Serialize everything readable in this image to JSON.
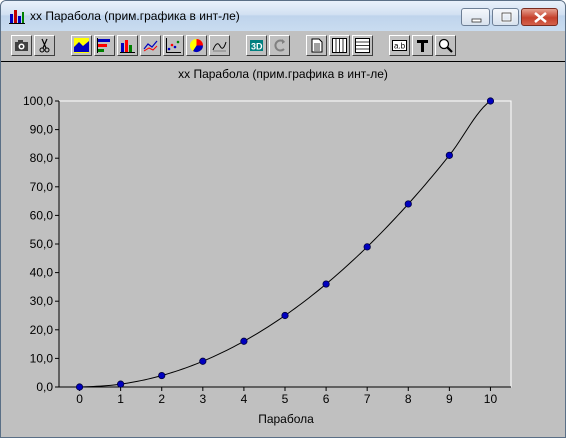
{
  "window": {
    "title": "xx Парабола (прим.графика в инт-ле)"
  },
  "toolbar": {
    "buttons": [
      {
        "icon": "camera-icon"
      },
      {
        "icon": "scissors-icon"
      },
      {
        "icon": "area-chart-icon"
      },
      {
        "icon": "horizontal-bar-chart-icon"
      },
      {
        "icon": "bar-chart-icon"
      },
      {
        "icon": "line-chart-icon"
      },
      {
        "icon": "scatter-chart-icon"
      },
      {
        "icon": "pie-chart-icon"
      },
      {
        "icon": "curve-chart-icon"
      },
      {
        "icon": "3d-toggle-icon"
      },
      {
        "icon": "rotate-icon"
      },
      {
        "icon": "document-icon"
      },
      {
        "icon": "vertical-grid-icon"
      },
      {
        "icon": "horizontal-grid-icon"
      },
      {
        "icon": "data-labels-icon"
      },
      {
        "icon": "font-tool-icon"
      },
      {
        "icon": "zoom-icon"
      }
    ]
  },
  "chart_data": {
    "type": "line",
    "title": "xx Парабола (прим.графика в инт-ле)",
    "xlabel": "Парабола",
    "ylabel": "",
    "x": [
      0,
      1,
      2,
      3,
      4,
      5,
      6,
      7,
      8,
      9,
      10
    ],
    "series": [
      {
        "values": [
          0,
          1,
          4,
          9,
          16,
          25,
          36,
          49,
          64,
          81,
          100
        ]
      }
    ],
    "xlim": [
      -0.5,
      10.5
    ],
    "ylim": [
      0,
      100
    ],
    "yticks": [
      "0,0",
      "10,0",
      "20,0",
      "30,0",
      "40,0",
      "50,0",
      "60,0",
      "70,0",
      "80,0",
      "90,0",
      "100,0"
    ],
    "xticks": [
      "0",
      "1",
      "2",
      "3",
      "4",
      "5",
      "6",
      "7",
      "8",
      "9",
      "10"
    ],
    "colors": {
      "line": "#000000",
      "marker": "#0000c0",
      "plot_bg": "#c0c0c0"
    },
    "grid": false,
    "legend": "none"
  }
}
